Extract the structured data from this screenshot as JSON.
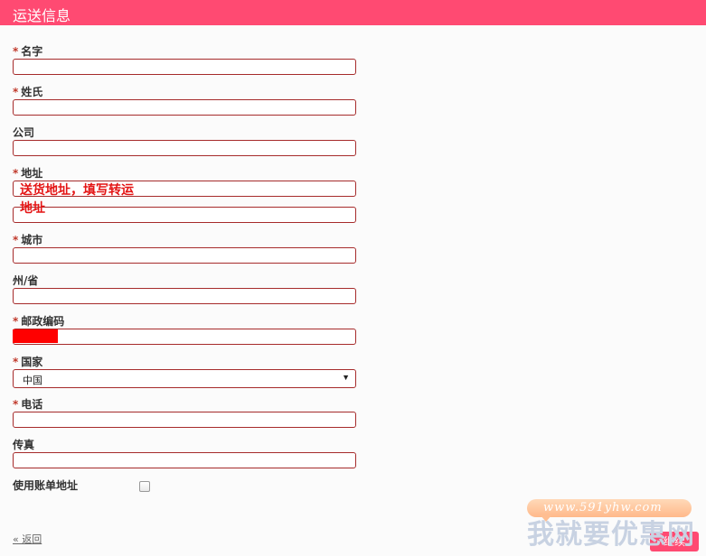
{
  "header": {
    "title": "运送信息"
  },
  "form": {
    "name": {
      "required": "*",
      "label": "名字",
      "value": ""
    },
    "surname": {
      "required": "*",
      "label": "姓氏",
      "value": ""
    },
    "company": {
      "label": "公司",
      "value": ""
    },
    "address": {
      "required": "*",
      "label": "地址",
      "value": "",
      "value2": ""
    },
    "city": {
      "required": "*",
      "label": "城市",
      "value": ""
    },
    "state": {
      "label": "州/省",
      "value": ""
    },
    "zip": {
      "required": "*",
      "label": "邮政编码",
      "value": ""
    },
    "country": {
      "required": "*",
      "label": "国家",
      "selected": "中国"
    },
    "phone": {
      "required": "*",
      "label": "电话",
      "value": ""
    },
    "fax": {
      "label": "传真",
      "value": ""
    },
    "use_billing": {
      "label": "使用账单地址",
      "checked": false
    }
  },
  "annotation": {
    "line1": "送货地址，填写转运",
    "line2": "地址",
    "color": "#e41414"
  },
  "footer": {
    "back_link": "« 返回",
    "continue_label": "继续"
  },
  "watermark": {
    "url": "www.591yhw.com",
    "brand": "我就要优惠网"
  },
  "colors": {
    "accent": "#ff4a72",
    "field_border": "#a62b2b",
    "required": "#c0392b"
  }
}
